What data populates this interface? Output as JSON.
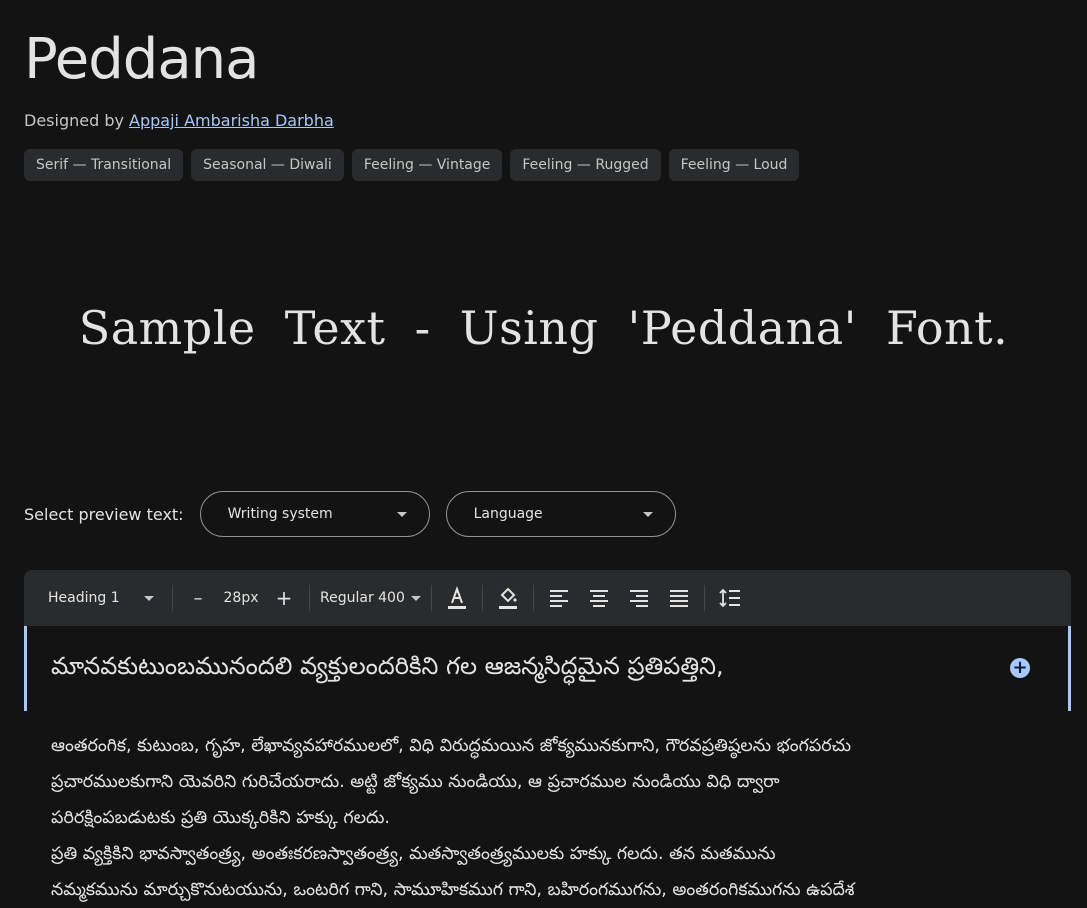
{
  "font": {
    "name": "Peddana",
    "designed_by_label": "Designed by",
    "designer": "Appaji Ambarisha Darbha"
  },
  "tags": [
    "Serif — Transitional",
    "Seasonal — Diwali",
    "Feeling — Vintage",
    "Feeling — Rugged",
    "Feeling — Loud"
  ],
  "sample_text": "Sample Text - Using 'Peddana' Font.",
  "preview": {
    "label": "Select preview text:",
    "writing_system": "Writing system",
    "language": "Language"
  },
  "toolbar": {
    "style": "Heading 1",
    "decrease": "–",
    "size": "28px",
    "increase": "+",
    "weight": "Regular 400"
  },
  "editor": {
    "heading": "మానవకుటుంబమునందలి వ్యక్తులందరికిని గల ఆజన్మసిద్ధమైన ప్రతిపత్తిని,",
    "paragraphs": [
      "ఆంతరంగిక, కుటుంబ, గృహ, లేఖావ్యవహారములలో, విధి విరుద్ధమయిన జోక్యమునకుగాని, గౌరవప్రతిష్ఠలను భంగపరచు",
      "ప్రచారములకుగాని యెవరిని గురిచేయరాదు. అట్టి జోక్యము నుండియు, ఆ ప్రచారముల నుండియు విధి ద్వారా",
      "పరిరక్షింపబడుటకు ప్రతి యొక్కరికిని హక్కు గలదు.",
      "ప్రతి వ్యక్తికిని భావస్వాతంత్ర్య, అంతఃకరణస్వాతంత్ర్య, మతస్వాతంత్ర్యములకు హక్కు గలదు. తన మతమును",
      "నమ్మకమును మార్చుకొనుటయును, ఒంటరిగ గాని, సామూహికముగ గాని, బహిరంగముగను, అంతరంగికముగను ఉపదేశ"
    ]
  },
  "colors": {
    "background": "#131313",
    "link": "#a8c7fa",
    "toolbar": "#2a2b2c"
  }
}
